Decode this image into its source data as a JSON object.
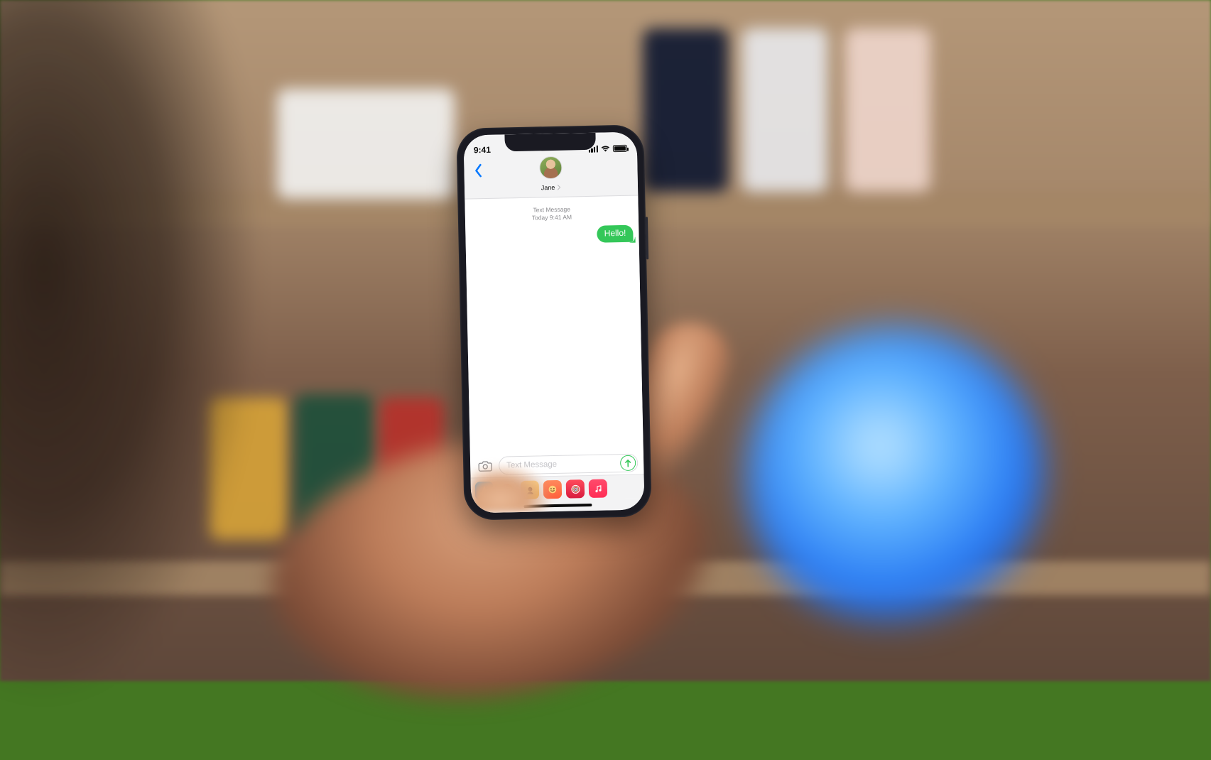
{
  "status": {
    "time": "9:41"
  },
  "header": {
    "contact_name": "Jane"
  },
  "thread": {
    "meta_line1": "Text Message",
    "meta_line2_prefix": "Today",
    "meta_line2_time": "9:41 AM",
    "messages": [
      {
        "from": "me",
        "text": "Hello!"
      }
    ]
  },
  "compose": {
    "placeholder": "Text Message"
  },
  "colors": {
    "sms_green": "#34c759",
    "ios_blue": "#0a7aff"
  }
}
